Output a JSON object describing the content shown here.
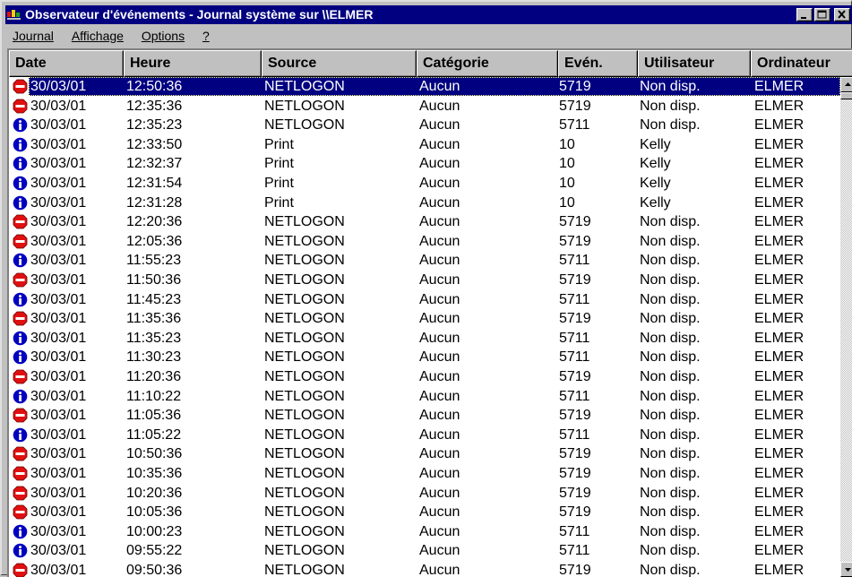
{
  "window": {
    "title": "Observateur d'événements - Journal système sur \\\\ELMER",
    "controls": [
      "minimize-icon",
      "maximize-icon",
      "close-icon"
    ]
  },
  "menu": [
    {
      "label": "Journal"
    },
    {
      "label": "Affichage"
    },
    {
      "label": "Options"
    },
    {
      "label": "?"
    }
  ],
  "columns": [
    "Date",
    "Heure",
    "Source",
    "Catégorie",
    "Evén.",
    "Utilisateur",
    "Ordinateur"
  ],
  "icons": {
    "error": "stop-icon",
    "info": "info-icon"
  },
  "colors": {
    "title_bar": "#000080",
    "selection": "#000080",
    "error": "#e01010",
    "info": "#0000c0"
  },
  "rows": [
    {
      "type": "error",
      "date": "30/03/01",
      "time": "12:50:36",
      "source": "NETLOGON",
      "category": "Aucun",
      "event": "5719",
      "user": "Non disp.",
      "computer": "ELMER",
      "selected": true
    },
    {
      "type": "error",
      "date": "30/03/01",
      "time": "12:35:36",
      "source": "NETLOGON",
      "category": "Aucun",
      "event": "5719",
      "user": "Non disp.",
      "computer": "ELMER"
    },
    {
      "type": "info",
      "date": "30/03/01",
      "time": "12:35:23",
      "source": "NETLOGON",
      "category": "Aucun",
      "event": "5711",
      "user": "Non disp.",
      "computer": "ELMER"
    },
    {
      "type": "info",
      "date": "30/03/01",
      "time": "12:33:50",
      "source": "Print",
      "category": "Aucun",
      "event": "10",
      "user": "Kelly",
      "computer": "ELMER"
    },
    {
      "type": "info",
      "date": "30/03/01",
      "time": "12:32:37",
      "source": "Print",
      "category": "Aucun",
      "event": "10",
      "user": "Kelly",
      "computer": "ELMER"
    },
    {
      "type": "info",
      "date": "30/03/01",
      "time": "12:31:54",
      "source": "Print",
      "category": "Aucun",
      "event": "10",
      "user": "Kelly",
      "computer": "ELMER"
    },
    {
      "type": "info",
      "date": "30/03/01",
      "time": "12:31:28",
      "source": "Print",
      "category": "Aucun",
      "event": "10",
      "user": "Kelly",
      "computer": "ELMER"
    },
    {
      "type": "error",
      "date": "30/03/01",
      "time": "12:20:36",
      "source": "NETLOGON",
      "category": "Aucun",
      "event": "5719",
      "user": "Non disp.",
      "computer": "ELMER"
    },
    {
      "type": "error",
      "date": "30/03/01",
      "time": "12:05:36",
      "source": "NETLOGON",
      "category": "Aucun",
      "event": "5719",
      "user": "Non disp.",
      "computer": "ELMER"
    },
    {
      "type": "info",
      "date": "30/03/01",
      "time": "11:55:23",
      "source": "NETLOGON",
      "category": "Aucun",
      "event": "5711",
      "user": "Non disp.",
      "computer": "ELMER"
    },
    {
      "type": "error",
      "date": "30/03/01",
      "time": "11:50:36",
      "source": "NETLOGON",
      "category": "Aucun",
      "event": "5719",
      "user": "Non disp.",
      "computer": "ELMER"
    },
    {
      "type": "info",
      "date": "30/03/01",
      "time": "11:45:23",
      "source": "NETLOGON",
      "category": "Aucun",
      "event": "5711",
      "user": "Non disp.",
      "computer": "ELMER"
    },
    {
      "type": "error",
      "date": "30/03/01",
      "time": "11:35:36",
      "source": "NETLOGON",
      "category": "Aucun",
      "event": "5719",
      "user": "Non disp.",
      "computer": "ELMER"
    },
    {
      "type": "info",
      "date": "30/03/01",
      "time": "11:35:23",
      "source": "NETLOGON",
      "category": "Aucun",
      "event": "5711",
      "user": "Non disp.",
      "computer": "ELMER"
    },
    {
      "type": "info",
      "date": "30/03/01",
      "time": "11:30:23",
      "source": "NETLOGON",
      "category": "Aucun",
      "event": "5711",
      "user": "Non disp.",
      "computer": "ELMER"
    },
    {
      "type": "error",
      "date": "30/03/01",
      "time": "11:20:36",
      "source": "NETLOGON",
      "category": "Aucun",
      "event": "5719",
      "user": "Non disp.",
      "computer": "ELMER"
    },
    {
      "type": "info",
      "date": "30/03/01",
      "time": "11:10:22",
      "source": "NETLOGON",
      "category": "Aucun",
      "event": "5711",
      "user": "Non disp.",
      "computer": "ELMER"
    },
    {
      "type": "error",
      "date": "30/03/01",
      "time": "11:05:36",
      "source": "NETLOGON",
      "category": "Aucun",
      "event": "5719",
      "user": "Non disp.",
      "computer": "ELMER"
    },
    {
      "type": "info",
      "date": "30/03/01",
      "time": "11:05:22",
      "source": "NETLOGON",
      "category": "Aucun",
      "event": "5711",
      "user": "Non disp.",
      "computer": "ELMER"
    },
    {
      "type": "error",
      "date": "30/03/01",
      "time": "10:50:36",
      "source": "NETLOGON",
      "category": "Aucun",
      "event": "5719",
      "user": "Non disp.",
      "computer": "ELMER"
    },
    {
      "type": "error",
      "date": "30/03/01",
      "time": "10:35:36",
      "source": "NETLOGON",
      "category": "Aucun",
      "event": "5719",
      "user": "Non disp.",
      "computer": "ELMER"
    },
    {
      "type": "error",
      "date": "30/03/01",
      "time": "10:20:36",
      "source": "NETLOGON",
      "category": "Aucun",
      "event": "5719",
      "user": "Non disp.",
      "computer": "ELMER"
    },
    {
      "type": "error",
      "date": "30/03/01",
      "time": "10:05:36",
      "source": "NETLOGON",
      "category": "Aucun",
      "event": "5719",
      "user": "Non disp.",
      "computer": "ELMER"
    },
    {
      "type": "info",
      "date": "30/03/01",
      "time": "10:00:23",
      "source": "NETLOGON",
      "category": "Aucun",
      "event": "5711",
      "user": "Non disp.",
      "computer": "ELMER"
    },
    {
      "type": "info",
      "date": "30/03/01",
      "time": "09:55:22",
      "source": "NETLOGON",
      "category": "Aucun",
      "event": "5711",
      "user": "Non disp.",
      "computer": "ELMER"
    },
    {
      "type": "error",
      "date": "30/03/01",
      "time": "09:50:36",
      "source": "NETLOGON",
      "category": "Aucun",
      "event": "5719",
      "user": "Non disp.",
      "computer": "ELMER"
    }
  ]
}
